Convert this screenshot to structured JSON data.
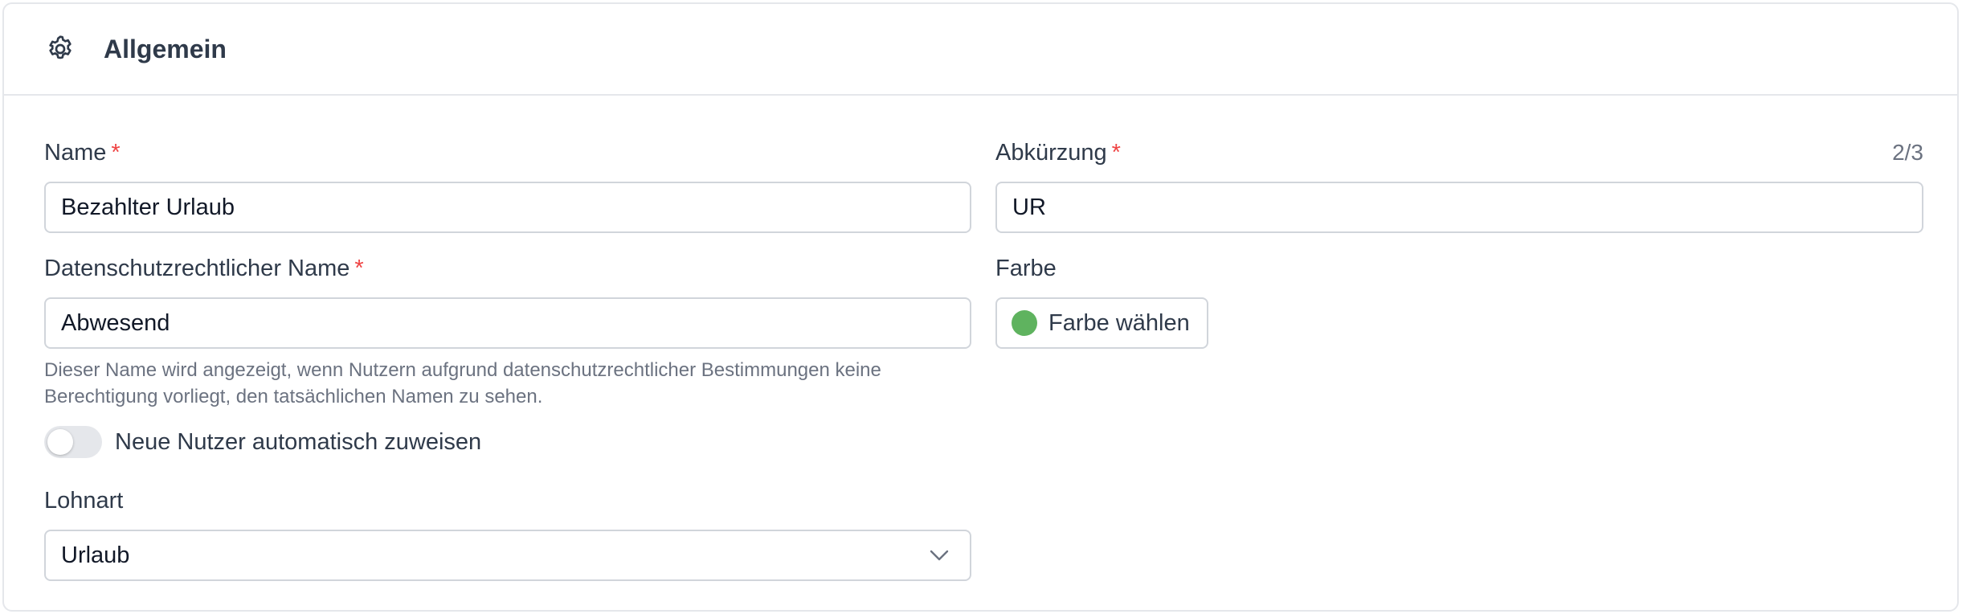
{
  "section": {
    "title": "Allgemein",
    "icon": "gear-icon"
  },
  "fields": {
    "name": {
      "label": "Name",
      "required": "*",
      "value": "Bezahlter Urlaub"
    },
    "abbreviation": {
      "label": "Abkürzung",
      "required": "*",
      "counter": "2/3",
      "value": "UR"
    },
    "privacy_name": {
      "label": "Datenschutzrechtlicher Name",
      "required": "*",
      "value": "Abwesend",
      "hint": "Dieser Name wird angezeigt, wenn Nutzern aufgrund datenschutzrechtlicher Bestimmungen keine Berechtigung vorliegt, den tatsächlichen Namen zu sehen."
    },
    "color": {
      "label": "Farbe",
      "button_label": "Farbe wählen",
      "swatch": "#5fb35f"
    },
    "auto_assign": {
      "label": "Neue Nutzer automatisch zuweisen",
      "enabled": false
    },
    "wage_type": {
      "label": "Lohnart",
      "value": "Urlaub",
      "icon": "chevron-down-icon"
    }
  },
  "colors": {
    "border": "#d1d5db",
    "required": "#ef4444",
    "text": "#2f3a4a",
    "hint": "#6b7280"
  }
}
